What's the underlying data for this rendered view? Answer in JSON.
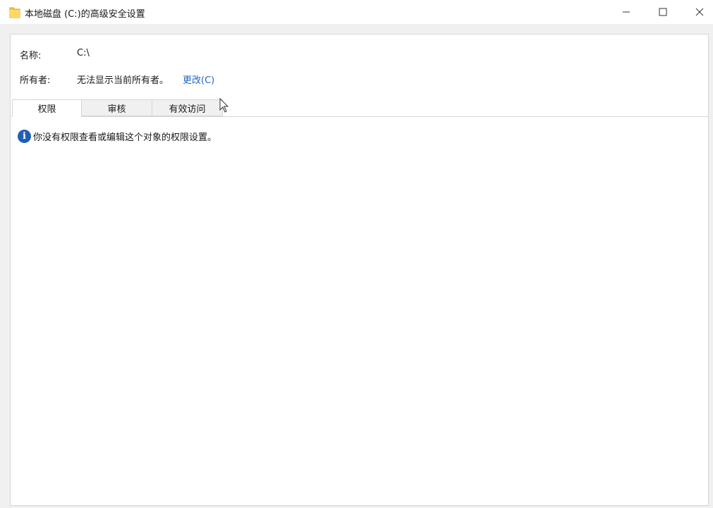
{
  "window": {
    "title": "本地磁盘 (C:)的高级安全设置",
    "icon": "folder-icon",
    "controls": {
      "minimize_icon": "minimize-icon",
      "maximize_icon": "maximize-icon",
      "close_icon": "close-icon"
    }
  },
  "fields": {
    "name_label": "名称:",
    "name_value": "C:\\",
    "owner_label": "所有者:",
    "owner_value": "无法显示当前所有者。",
    "change_link": "更改(C)"
  },
  "tabs": [
    {
      "label": "权限",
      "active": true
    },
    {
      "label": "审核",
      "active": false
    },
    {
      "label": "有效访问",
      "active": false
    }
  ],
  "message": {
    "icon": "info-icon",
    "icon_glyph": "i",
    "text": "你没有权限查看或编辑这个对象的权限设置。"
  },
  "colors": {
    "link": "#1e66c6",
    "info_icon": "#1f5fb4",
    "folder": "#f6c244"
  }
}
